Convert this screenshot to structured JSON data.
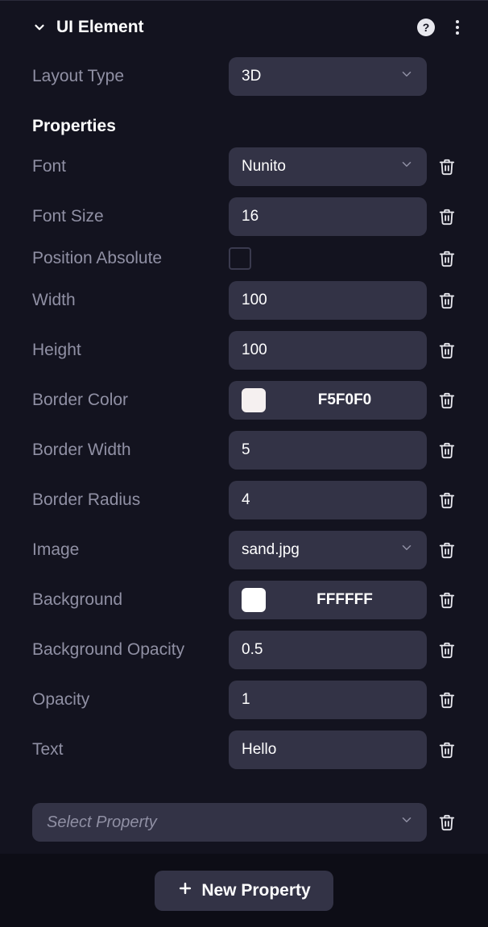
{
  "header": {
    "title": "UI Element"
  },
  "layout": {
    "label": "Layout Type",
    "value": "3D"
  },
  "propertiesTitle": "Properties",
  "properties": {
    "font": {
      "label": "Font",
      "value": "Nunito"
    },
    "fontSize": {
      "label": "Font Size",
      "value": "16"
    },
    "positionAbsolute": {
      "label": "Position Absolute",
      "checked": false
    },
    "width": {
      "label": "Width",
      "value": "100"
    },
    "height": {
      "label": "Height",
      "value": "100"
    },
    "borderColor": {
      "label": "Border Color",
      "value": "F5F0F0",
      "swatch": "#F5F0F0"
    },
    "borderWidth": {
      "label": "Border Width",
      "value": "5"
    },
    "borderRadius": {
      "label": "Border Radius",
      "value": "4"
    },
    "image": {
      "label": "Image",
      "value": "sand.jpg"
    },
    "background": {
      "label": "Background",
      "value": "FFFFFF",
      "swatch": "#FFFFFF"
    },
    "backgroundOpacity": {
      "label": "Background Opacity",
      "value": "0.5"
    },
    "opacity": {
      "label": "Opacity",
      "value": "1"
    },
    "text": {
      "label": "Text",
      "value": "Hello"
    }
  },
  "selectProperty": {
    "placeholder": "Select Property"
  },
  "newProperty": {
    "label": "New Property"
  }
}
